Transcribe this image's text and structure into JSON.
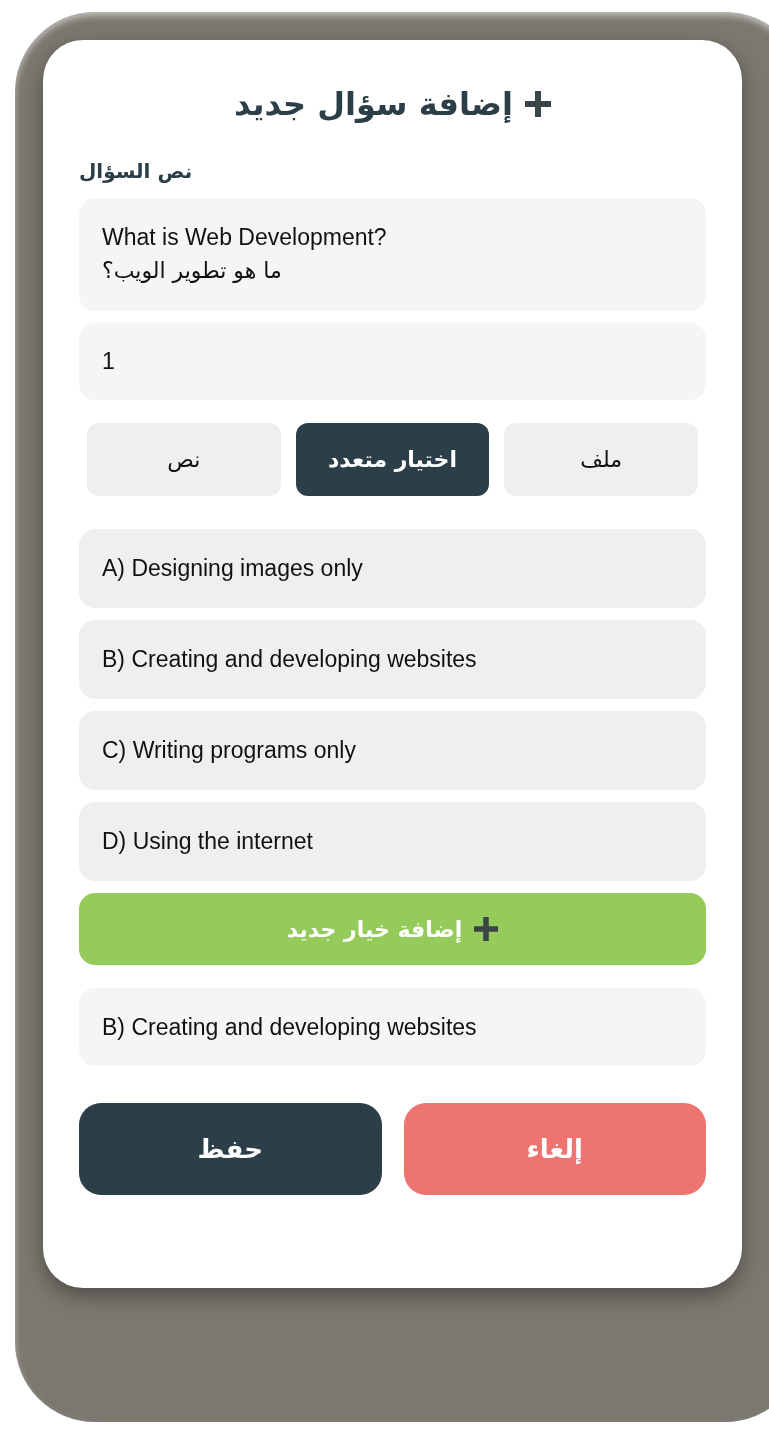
{
  "title": "إضافة سؤال جديد",
  "question_label": "نص السؤال",
  "question_field": {
    "lines": [
      "What is Web Development?",
      "ما هو تطوير الويب؟"
    ]
  },
  "points_field": {
    "value": "1"
  },
  "answer_types": [
    {
      "label": "ملف",
      "selected": false
    },
    {
      "label": "اختيار متعدد",
      "selected": true
    },
    {
      "label": "نص",
      "selected": false
    }
  ],
  "options": [
    {
      "value": "A) Designing images only"
    },
    {
      "value": "B) Creating and developing websites"
    },
    {
      "value": "C) Writing programs only"
    },
    {
      "value": "D) Using the internet"
    }
  ],
  "add_option_button": {
    "label": "إضافة خيار جديد"
  },
  "correct_answer_field": {
    "value": "B) Creating and developing websites"
  },
  "buttons": [
    {
      "kind": "cancel",
      "label": "إلغاء"
    },
    {
      "kind": "save",
      "label": "حفظ"
    }
  ]
}
